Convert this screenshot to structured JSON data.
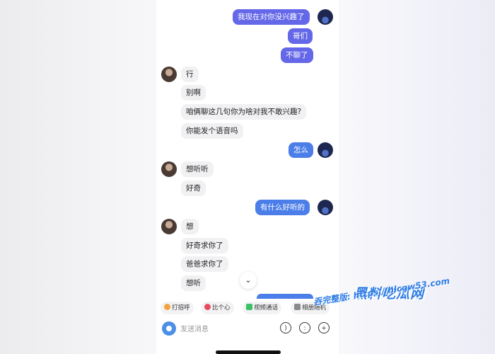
{
  "chat": {
    "messages": [
      {
        "text": "我现在对你没兴趣了"
      },
      {
        "text": "哥们"
      },
      {
        "text": "不聊了"
      },
      {
        "text": "行"
      },
      {
        "text": "别啊"
      },
      {
        "text": "咱俩聊这几句你为啥对我不敢兴趣?"
      },
      {
        "text": "你能发个语音吗"
      },
      {
        "text": "怎么"
      },
      {
        "text": "想听听"
      },
      {
        "text": "好奇"
      },
      {
        "text": "有什么好听的"
      },
      {
        "text": "想"
      },
      {
        "text": "好奇求你了"
      },
      {
        "text": "爸爸求你了"
      },
      {
        "text": "想听"
      }
    ],
    "scroll_down_glyph": "⌄"
  },
  "quick_actions": [
    {
      "label": "打招呼",
      "icon": "wave-icon",
      "color": "#f2a33a"
    },
    {
      "label": "比个心",
      "icon": "heart-icon",
      "color": "#e84a5f"
    },
    {
      "label": "视频通话",
      "icon": "video-icon",
      "color": "#3cc26b"
    },
    {
      "label": "相册随机",
      "icon": "dice-icon",
      "color": "#8a8a8a"
    }
  ],
  "input": {
    "placeholder": "发送消息"
  },
  "watermark": {
    "line1": "黑料吃瓜网",
    "line2": "吞完整版: https://hlcgw53.com"
  }
}
